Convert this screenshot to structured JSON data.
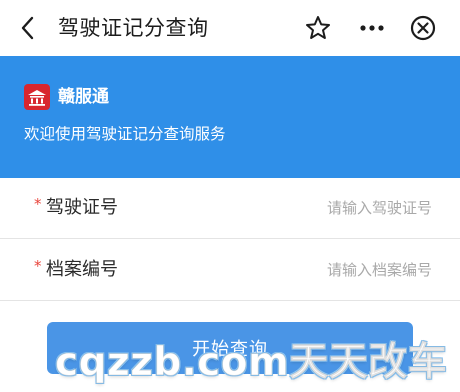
{
  "header": {
    "title": "驾驶证记分查询",
    "icons": [
      "chevron-left-icon",
      "star-icon",
      "more-icon",
      "close-icon"
    ]
  },
  "banner": {
    "brand": "赣服通",
    "welcome": "欢迎使用驾驶证记分查询服务",
    "background_color": "#2f8fe8",
    "logo_color": "#d8262f"
  },
  "form": {
    "fields": [
      {
        "required_mark": "*",
        "label": "驾驶证号",
        "placeholder": "请输入驾驶证号",
        "value": ""
      },
      {
        "required_mark": "*",
        "label": "档案编号",
        "placeholder": "请输入档案编号",
        "value": ""
      }
    ],
    "submit_label": "开始查询",
    "submit_color": "#4a95e6"
  },
  "watermark": {
    "text": "cqzzb.com天天改车"
  }
}
